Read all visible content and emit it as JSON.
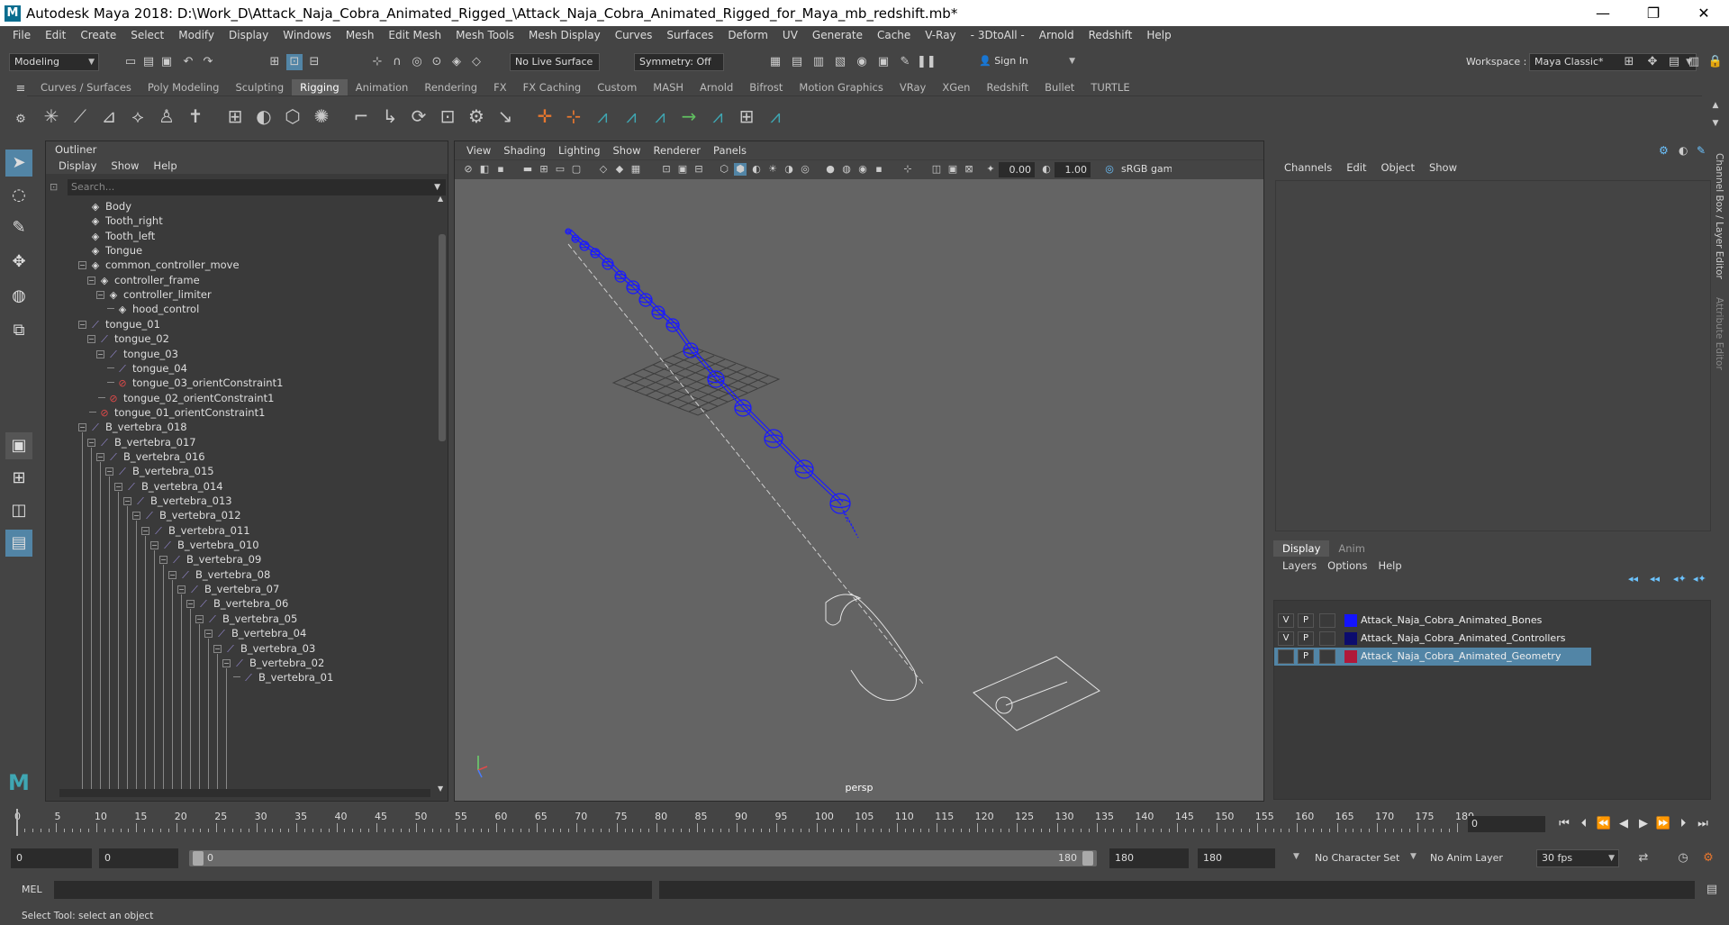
{
  "window": {
    "title": "Autodesk Maya 2018: D:\\Work_D\\Attack_Naja_Cobra_Animated_Rigged_\\Attack_Naja_Cobra_Animated_Rigged_for_Maya_mb_redshift.mb*",
    "logo": "M",
    "minimize": "—",
    "restore": "❐",
    "close": "✕"
  },
  "menubar": [
    "File",
    "Edit",
    "Create",
    "Select",
    "Modify",
    "Display",
    "Windows",
    "Mesh",
    "Edit Mesh",
    "Mesh Tools",
    "Mesh Display",
    "Curves",
    "Surfaces",
    "Deform",
    "UV",
    "Generate",
    "Cache",
    "V-Ray",
    "- 3DtoAll -",
    "Arnold",
    "Redshift",
    "Help"
  ],
  "statusline": {
    "menuset": "Modeling",
    "live_surface": "No Live Surface",
    "symmetry": "Symmetry: Off",
    "sign_in": "Sign In",
    "workspace_label": "Workspace :",
    "workspace": "Maya Classic*"
  },
  "shelf_tabs": [
    "Curves / Surfaces",
    "Poly Modeling",
    "Sculpting",
    "Rigging",
    "Animation",
    "Rendering",
    "FX",
    "FX Caching",
    "Custom",
    "MASH",
    "Arnold",
    "Bifrost",
    "Motion Graphics",
    "VRay",
    "XGen",
    "Redshift",
    "Bullet",
    "TURTLE"
  ],
  "shelf_active_tab": "Rigging",
  "outliner": {
    "title": "Outliner",
    "menus": [
      "Display",
      "Show",
      "Help"
    ],
    "search_placeholder": "Search...",
    "items": [
      {
        "label": "Body",
        "type": "xform",
        "depth": 1
      },
      {
        "label": "Tooth_right",
        "type": "xform",
        "depth": 1
      },
      {
        "label": "Tooth_left",
        "type": "xform",
        "depth": 1
      },
      {
        "label": "Tongue",
        "type": "xform",
        "depth": 1
      },
      {
        "label": "common_controller_move",
        "type": "xform",
        "depth": 1
      },
      {
        "label": "controller_frame",
        "type": "xform",
        "depth": 2
      },
      {
        "label": "controller_limiter",
        "type": "xform",
        "depth": 3
      },
      {
        "label": "hood_control",
        "type": "xform",
        "depth": 4
      },
      {
        "label": "tongue_01",
        "type": "joint",
        "depth": 1
      },
      {
        "label": "tongue_02",
        "type": "joint",
        "depth": 2
      },
      {
        "label": "tongue_03",
        "type": "joint",
        "depth": 3
      },
      {
        "label": "tongue_04",
        "type": "joint",
        "depth": 4
      },
      {
        "label": "tongue_03_orientConstraint1",
        "type": "cons",
        "depth": 4
      },
      {
        "label": "tongue_02_orientConstraint1",
        "type": "cons",
        "depth": 3
      },
      {
        "label": "tongue_01_orientConstraint1",
        "type": "cons",
        "depth": 2
      },
      {
        "label": "B_vertebra_018",
        "type": "joint",
        "depth": 1
      },
      {
        "label": "B_vertebra_017",
        "type": "joint",
        "depth": 2
      },
      {
        "label": "B_vertebra_016",
        "type": "joint",
        "depth": 3
      },
      {
        "label": "B_vertebra_015",
        "type": "joint",
        "depth": 4
      },
      {
        "label": "B_vertebra_014",
        "type": "joint",
        "depth": 5
      },
      {
        "label": "B_vertebra_013",
        "type": "joint",
        "depth": 6
      },
      {
        "label": "B_vertebra_012",
        "type": "joint",
        "depth": 7
      },
      {
        "label": "B_vertebra_011",
        "type": "joint",
        "depth": 8
      },
      {
        "label": "B_vertebra_010",
        "type": "joint",
        "depth": 9
      },
      {
        "label": "B_vertebra_09",
        "type": "joint",
        "depth": 10
      },
      {
        "label": "B_vertebra_08",
        "type": "joint",
        "depth": 11
      },
      {
        "label": "B_vertebra_07",
        "type": "joint",
        "depth": 12
      },
      {
        "label": "B_vertebra_06",
        "type": "joint",
        "depth": 13
      },
      {
        "label": "B_vertebra_05",
        "type": "joint",
        "depth": 14
      },
      {
        "label": "B_vertebra_04",
        "type": "joint",
        "depth": 15
      },
      {
        "label": "B_vertebra_03",
        "type": "joint",
        "depth": 16
      },
      {
        "label": "B_vertebra_02",
        "type": "joint",
        "depth": 17
      },
      {
        "label": "B_vertebra_01",
        "type": "joint",
        "depth": 18
      }
    ]
  },
  "viewport": {
    "menus": [
      "View",
      "Shading",
      "Lighting",
      "Show",
      "Renderer",
      "Panels"
    ],
    "exposure": "0.00",
    "gamma": "1.00",
    "colorspace": "sRGB gamma",
    "camera": "persp",
    "wire_color": "#1a1aff"
  },
  "channelbox": {
    "menus": [
      "Channels",
      "Edit",
      "Object",
      "Show"
    ]
  },
  "layer_editor": {
    "tabs": [
      "Display",
      "Anim"
    ],
    "menus": [
      "Layers",
      "Options",
      "Help"
    ],
    "layers": [
      {
        "v": "V",
        "p": "P",
        "color": "#1414ff",
        "name": "Attack_Naja_Cobra_Animated_Bones",
        "selected": false
      },
      {
        "v": "V",
        "p": "P",
        "color": "#0c0c6e",
        "name": "Attack_Naja_Cobra_Animated_Controllers",
        "selected": false
      },
      {
        "v": "",
        "p": "P",
        "color": "#b0193a",
        "name": "Attack_Naja_Cobra_Animated_Geometry",
        "selected": true
      }
    ]
  },
  "side_tabs": [
    "Channel Box / Layer Editor",
    "Attribute Editor"
  ],
  "timeslider": {
    "ticks": [
      "0",
      "5",
      "10",
      "15",
      "20",
      "25",
      "30",
      "35",
      "40",
      "45",
      "50",
      "55",
      "60",
      "65",
      "70",
      "75",
      "80",
      "85",
      "90",
      "95",
      "100",
      "105",
      "110",
      "115",
      "120",
      "125",
      "130",
      "135",
      "140",
      "145",
      "150",
      "155",
      "160",
      "165",
      "170",
      "175",
      "180"
    ],
    "current_frame": "0"
  },
  "range": {
    "start": "0",
    "anim_start": "0",
    "range_start": "0",
    "range_end": "180",
    "end": "180",
    "anim_end": "180",
    "character_set": "No Character Set",
    "anim_layer": "No Anim Layer",
    "fps": "30 fps"
  },
  "cmdline": {
    "lang": "MEL"
  },
  "helpline": "Select Tool: select an object"
}
